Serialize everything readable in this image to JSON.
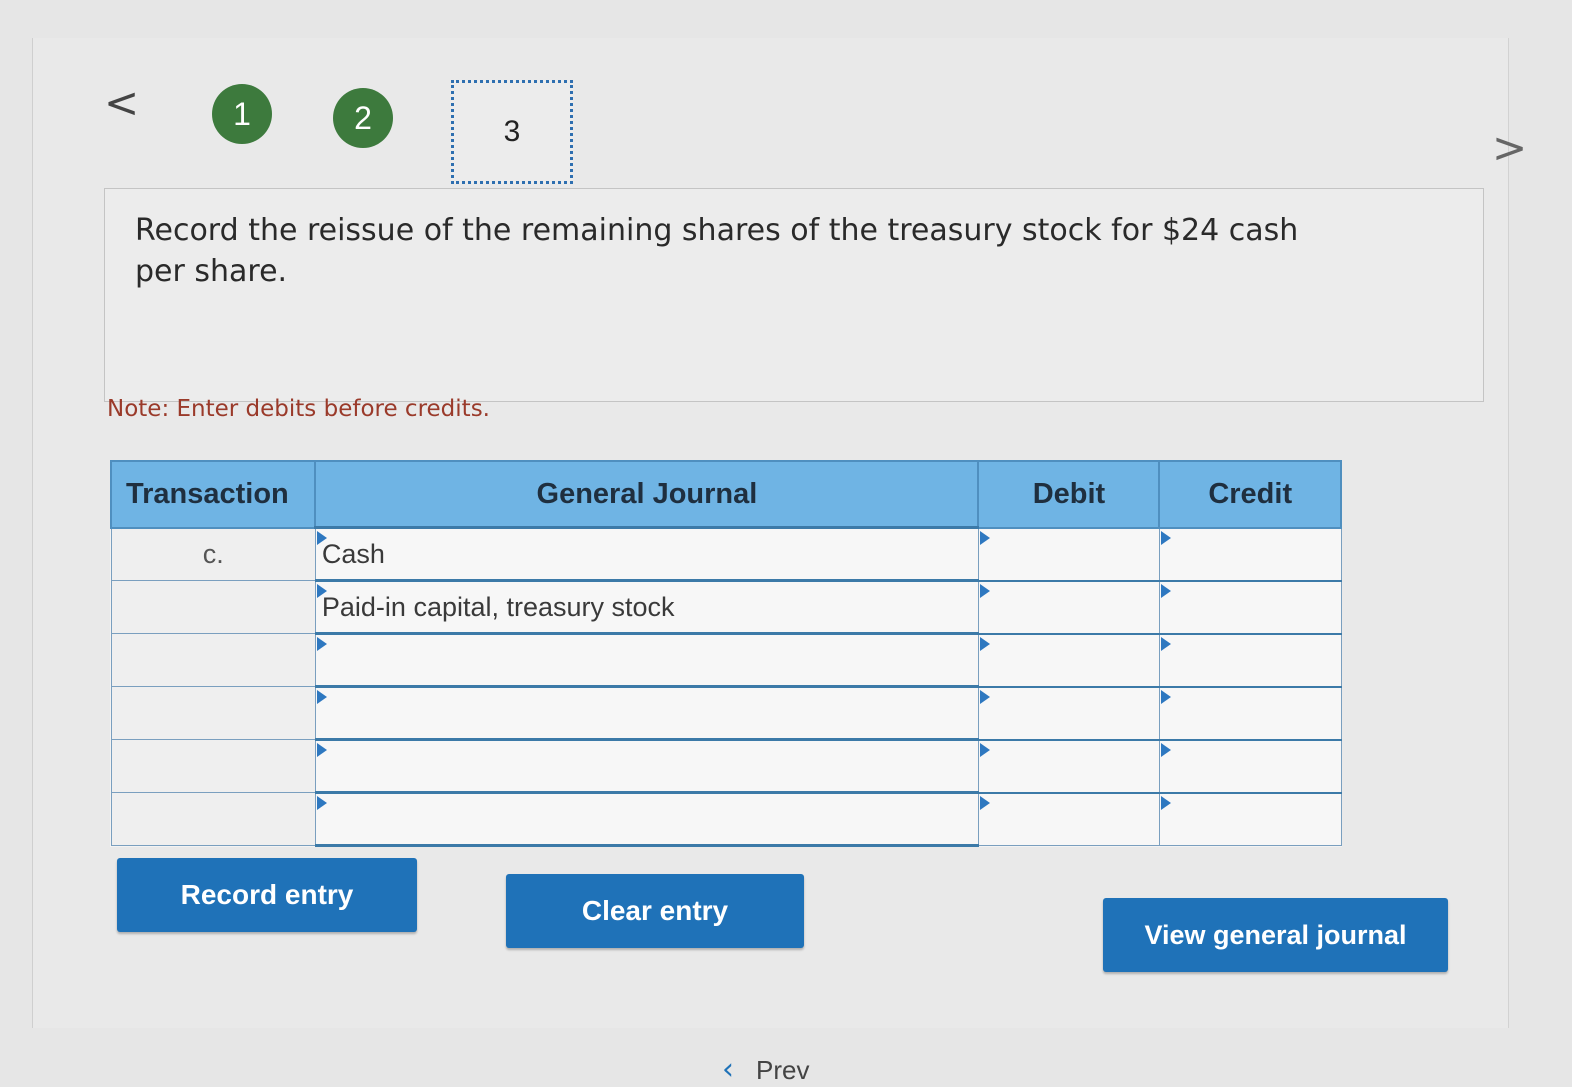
{
  "navigation": {
    "prev_arrow": "<",
    "next_arrow": ">",
    "steps": [
      "1",
      "2",
      "3"
    ],
    "current_step": "3"
  },
  "question": {
    "text": "Record the reissue of the remaining shares of the treasury stock for $24 cash per share."
  },
  "note": "Note: Enter debits before credits.",
  "journal": {
    "headers": {
      "transaction": "Transaction",
      "general_journal": "General Journal",
      "debit": "Debit",
      "credit": "Credit"
    },
    "rows": [
      {
        "transaction": "c.",
        "account": "Cash",
        "debit": "",
        "credit": ""
      },
      {
        "transaction": "",
        "account": "Paid-in capital, treasury stock",
        "debit": "",
        "credit": ""
      },
      {
        "transaction": "",
        "account": "",
        "debit": "",
        "credit": ""
      },
      {
        "transaction": "",
        "account": "",
        "debit": "",
        "credit": ""
      },
      {
        "transaction": "",
        "account": "",
        "debit": "",
        "credit": ""
      },
      {
        "transaction": "",
        "account": "",
        "debit": "",
        "credit": ""
      }
    ]
  },
  "buttons": {
    "record_entry": "Record entry",
    "clear_entry": "Clear entry",
    "view_general_journal": "View general journal"
  },
  "bottom_nav": {
    "prev_label": "Prev"
  },
  "colors": {
    "header_blue": "#6fb4e4",
    "button_blue": "#1f72b8",
    "step_green": "#3d7a3d",
    "note_red": "#9a3a2a"
  }
}
